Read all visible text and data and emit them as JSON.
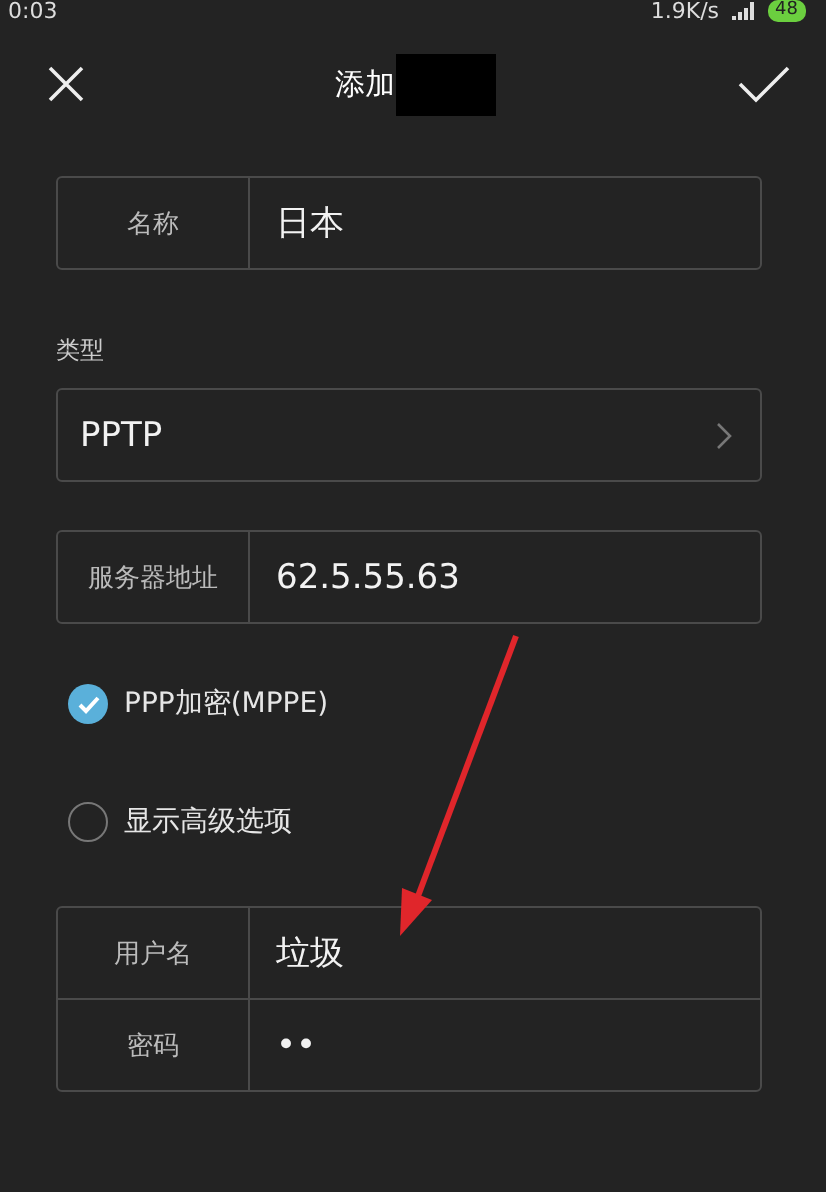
{
  "status_bar": {
    "time": "0:03",
    "speed": "1.9K/s",
    "battery": "48"
  },
  "header": {
    "title": "添加",
    "title_redacted": true
  },
  "fields": [
    {
      "kind": "labeled",
      "label": "名称",
      "value": "日本"
    },
    {
      "kind": "section",
      "label": "类型"
    },
    {
      "kind": "select",
      "value": "PPTP"
    },
    {
      "kind": "labeled",
      "label": "服务器地址",
      "value": "62.5.55.63"
    }
  ],
  "options": [
    {
      "label": "PPP加密(MPPE)",
      "checked": true
    },
    {
      "label": "显示高级选项",
      "checked": false
    }
  ],
  "credentials": [
    {
      "label": "用户名",
      "value": "垃圾"
    },
    {
      "label": "密码",
      "value": "••"
    }
  ]
}
